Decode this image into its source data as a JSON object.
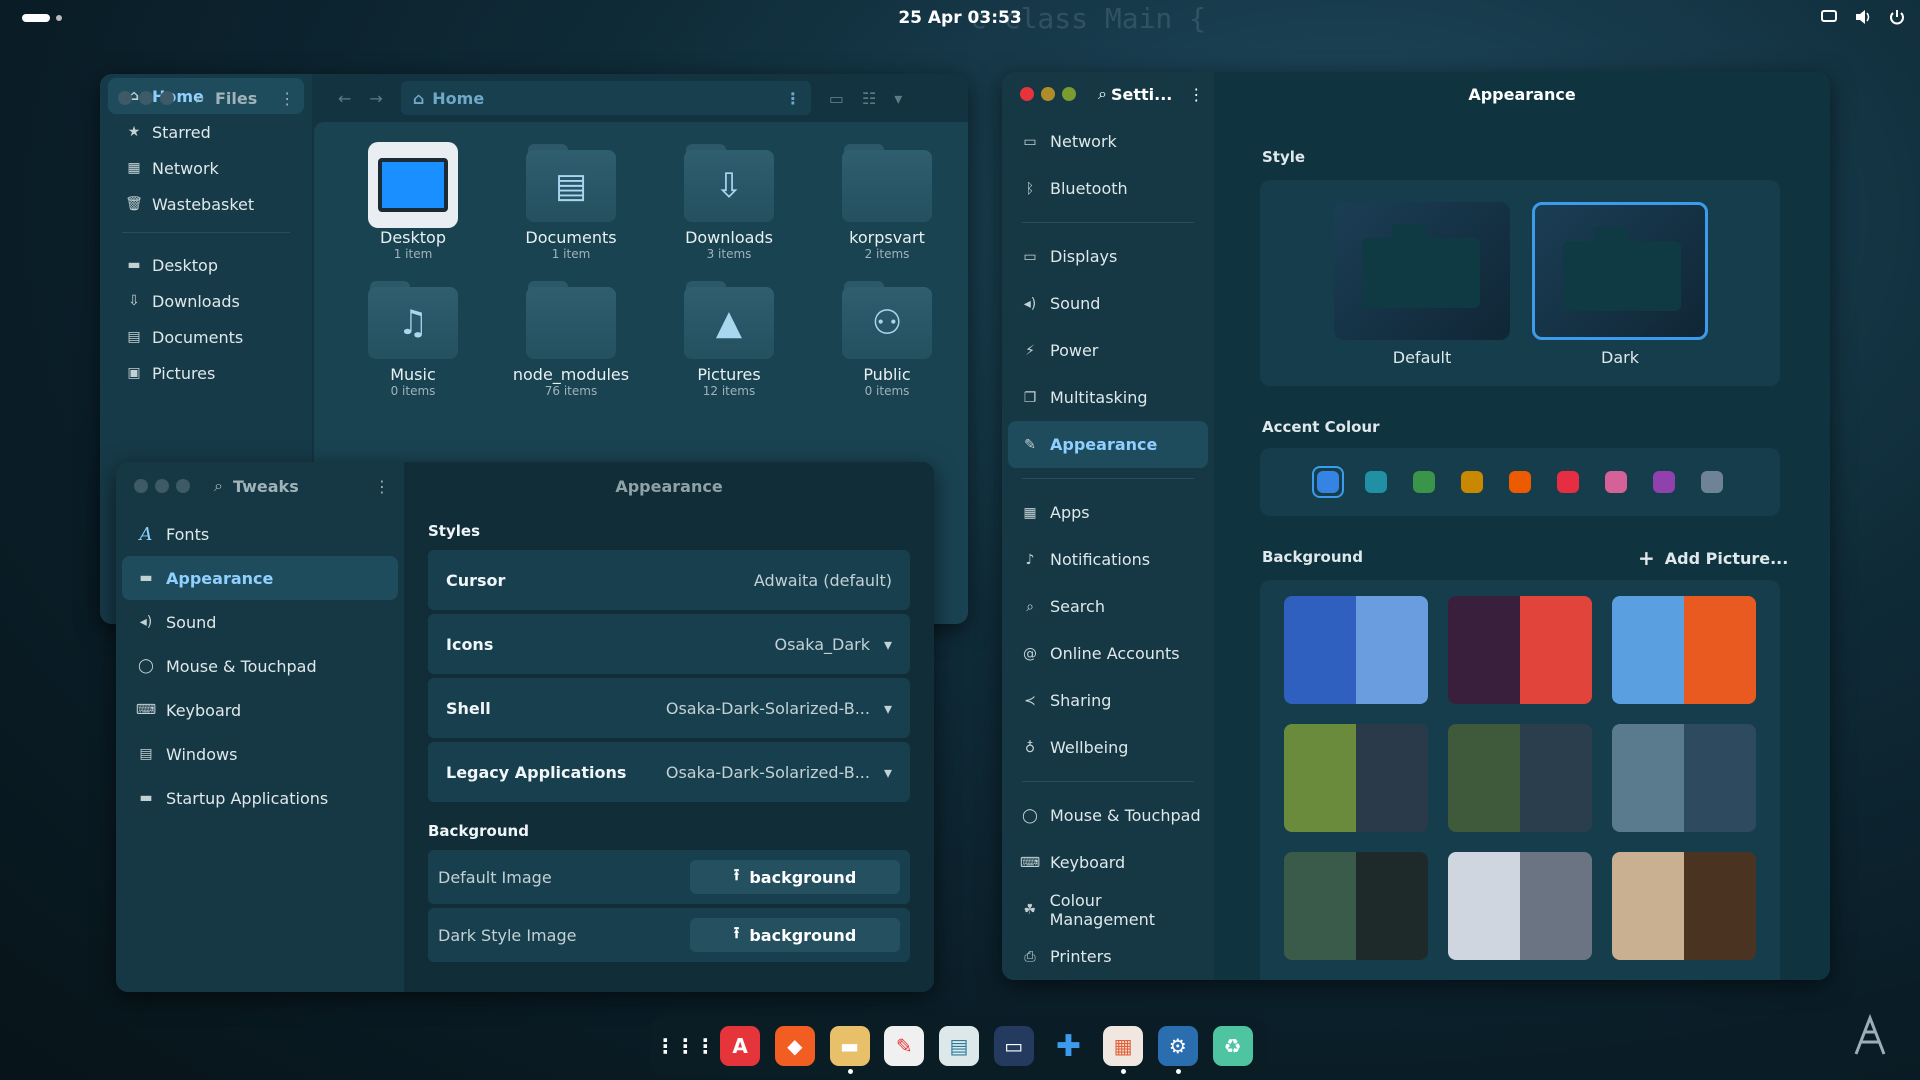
{
  "topbar": {
    "clock": "25 Apr  03:53"
  },
  "files": {
    "title": "Files",
    "location": "Home",
    "sidebar": [
      {
        "label": "Home",
        "icon": "home-icon",
        "glyph": "⌂",
        "selected": true
      },
      {
        "label": "Starred",
        "icon": "star-icon",
        "glyph": "★"
      },
      {
        "label": "Network",
        "icon": "network-icon",
        "glyph": "▦"
      },
      {
        "label": "Wastebasket",
        "icon": "trash-icon",
        "glyph": "🗑"
      },
      {
        "label": "Desktop",
        "icon": "folder-icon",
        "glyph": "▬"
      },
      {
        "label": "Downloads",
        "icon": "download-icon",
        "glyph": "⇩"
      },
      {
        "label": "Documents",
        "icon": "document-icon",
        "glyph": "▤"
      },
      {
        "label": "Pictures",
        "icon": "picture-icon",
        "glyph": "▣"
      }
    ],
    "items": [
      {
        "name": "Desktop",
        "sub": "1 item",
        "glyph": "▭"
      },
      {
        "name": "Documents",
        "sub": "1 item",
        "glyph": "▤"
      },
      {
        "name": "Downloads",
        "sub": "3 items",
        "glyph": "⇩"
      },
      {
        "name": "korpsvart",
        "sub": "2 items",
        "glyph": ""
      },
      {
        "name": "Music",
        "sub": "0 items",
        "glyph": "♫"
      },
      {
        "name": "node_modules",
        "sub": "76 items",
        "glyph": ""
      },
      {
        "name": "Pictures",
        "sub": "12 items",
        "glyph": "▲"
      },
      {
        "name": "Public",
        "sub": "0 items",
        "glyph": "⚇"
      }
    ]
  },
  "tweaks": {
    "title": "Tweaks",
    "header": "Appearance",
    "sidebar": [
      {
        "label": "Fonts",
        "icon": "font-icon",
        "glyph": "A"
      },
      {
        "label": "Appearance",
        "icon": "appearance-icon",
        "glyph": "▬",
        "selected": true
      },
      {
        "label": "Sound",
        "icon": "sound-icon",
        "glyph": "◂)"
      },
      {
        "label": "Mouse & Touchpad",
        "icon": "mouse-icon",
        "glyph": "◯"
      },
      {
        "label": "Keyboard",
        "icon": "keyboard-icon",
        "glyph": "⌨"
      },
      {
        "label": "Windows",
        "icon": "windows-icon",
        "glyph": "▤"
      },
      {
        "label": "Startup Applications",
        "icon": "folder-icon",
        "glyph": "▬"
      }
    ],
    "styles_heading": "Styles",
    "styles": [
      {
        "label": "Cursor",
        "value": "Adwaita (default)",
        "dropdown": false
      },
      {
        "label": "Icons",
        "value": "Osaka_Dark",
        "dropdown": true
      },
      {
        "label": "Shell",
        "value": "Osaka-Dark-Solarized-B...",
        "dropdown": true
      },
      {
        "label": "Legacy Applications",
        "value": "Osaka-Dark-Solarized-B...",
        "dropdown": true
      }
    ],
    "background_heading": "Background",
    "background": [
      {
        "label": "Default Image",
        "button": "background"
      },
      {
        "label": "Dark Style Image",
        "button": "background"
      }
    ]
  },
  "settings": {
    "title": "Setti...",
    "header": "Appearance",
    "sidebar": [
      {
        "label": "Network",
        "icon": "network-icon",
        "glyph": "▭"
      },
      {
        "label": "Bluetooth",
        "icon": "bluetooth-icon",
        "glyph": "ᛒ",
        "sep_after": true
      },
      {
        "label": "Displays",
        "icon": "display-icon",
        "glyph": "▭"
      },
      {
        "label": "Sound",
        "icon": "sound-icon",
        "glyph": "◂)"
      },
      {
        "label": "Power",
        "icon": "power-icon",
        "glyph": "⚡"
      },
      {
        "label": "Multitasking",
        "icon": "multitasking-icon",
        "glyph": "❐"
      },
      {
        "label": "Appearance",
        "icon": "appearance-icon",
        "glyph": "✎",
        "selected": true,
        "sep_after": true
      },
      {
        "label": "Apps",
        "icon": "apps-icon",
        "glyph": "▦"
      },
      {
        "label": "Notifications",
        "icon": "bell-icon",
        "glyph": "♪"
      },
      {
        "label": "Search",
        "icon": "search-icon",
        "glyph": "⌕"
      },
      {
        "label": "Online Accounts",
        "icon": "at-icon",
        "glyph": "@"
      },
      {
        "label": "Sharing",
        "icon": "share-icon",
        "glyph": "≺"
      },
      {
        "label": "Wellbeing",
        "icon": "wellbeing-icon",
        "glyph": "♁",
        "sep_after": true
      },
      {
        "label": "Mouse & Touchpad",
        "icon": "mouse-icon",
        "glyph": "◯"
      },
      {
        "label": "Keyboard",
        "icon": "keyboard-icon",
        "glyph": "⌨"
      },
      {
        "label": "Colour Management",
        "icon": "colour-icon",
        "glyph": "☘"
      },
      {
        "label": "Printers",
        "icon": "printer-icon",
        "glyph": "⎙"
      }
    ],
    "style_heading": "Style",
    "styles": [
      {
        "label": "Default"
      },
      {
        "label": "Dark",
        "selected": true
      }
    ],
    "accent_heading": "Accent Colour",
    "accents": [
      "#3584e4",
      "#2190a4",
      "#3a944a",
      "#c88800",
      "#ed5b00",
      "#e62d42",
      "#d56199",
      "#9141ac",
      "#6f8396"
    ],
    "background_heading": "Background",
    "add_picture": "Add Picture...",
    "wallpapers": [
      {
        "a": "#2f5fbf",
        "b": "#6a9de0"
      },
      {
        "a": "#3a1f3d",
        "b": "#e0443a"
      },
      {
        "a": "#5aa0e0",
        "b": "#e85a20"
      },
      {
        "a": "#6a8a3c",
        "b": "#2a3a4a"
      },
      {
        "a": "#3e5a3a",
        "b": "#2a3e4e"
      },
      {
        "a": "#5a7a8e",
        "b": "#2e4a5e"
      },
      {
        "a": "#3a5a4a",
        "b": "#1e2a2a"
      },
      {
        "a": "#cfd6e0",
        "b": "#6a7482"
      },
      {
        "a": "#c8b090",
        "b": "#4a3320"
      }
    ]
  },
  "dock": [
    "apps-grid",
    "app-center",
    "brave",
    "files",
    "text-editor",
    "reader",
    "terminal",
    "extensions",
    "tweaks",
    "settings",
    "trash"
  ]
}
